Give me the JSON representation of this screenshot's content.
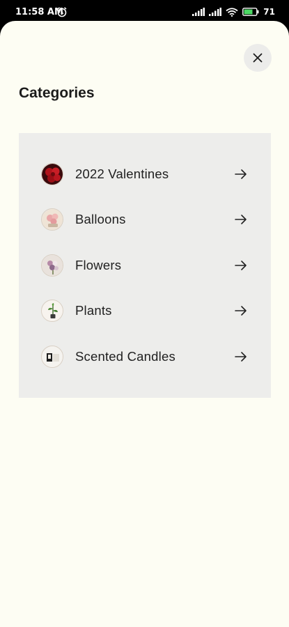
{
  "status": {
    "time": "11:58 AM",
    "battery_percent": "71"
  },
  "header": {
    "title": "Categories"
  },
  "categories": [
    {
      "label": "2022 Valentines",
      "thumbnail": "red-roses"
    },
    {
      "label": "Balloons",
      "thumbnail": "pink-balloons"
    },
    {
      "label": "Flowers",
      "thumbnail": "flower-bouquet"
    },
    {
      "label": "Plants",
      "thumbnail": "potted-plant"
    },
    {
      "label": "Scented Candles",
      "thumbnail": "candle-jar"
    }
  ],
  "icons": {
    "close": "close-icon",
    "arrow": "arrow-right-icon"
  },
  "colors": {
    "sheet_background": "#fdfdf3",
    "panel_background": "#ededeb",
    "close_button_background": "#ececea",
    "text": "#1f1f1f"
  }
}
